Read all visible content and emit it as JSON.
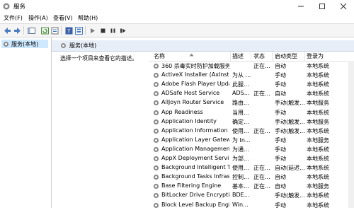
{
  "window": {
    "title": "服务"
  },
  "menu": [
    "文件(F)",
    "操作(A)",
    "查看(V)",
    "帮助(H)"
  ],
  "toolbar_icons": [
    "back-icon",
    "forward-icon",
    "console-tree-icon",
    "refresh-icon",
    "export-icon",
    "help-icon",
    "properties-icon",
    "play-icon",
    "stop-icon",
    "pause-icon",
    "restart-icon"
  ],
  "left_pane": {
    "item": "服务(本地)"
  },
  "right_pane": {
    "header": "服务(本地)",
    "description_hint": "选择一个项目来查看它的描述。"
  },
  "grid": {
    "columns": [
      "名称",
      "描述",
      "状态",
      "启动类型",
      "登录为"
    ],
    "rows": [
      {
        "name": "360 杀毒实时防护加载服务",
        "desc": "",
        "status": "正在...",
        "startup": "自动",
        "logon": "本地系统"
      },
      {
        "name": "ActiveX Installer (AxInstSV)",
        "desc": "为从 ...",
        "status": "",
        "startup": "手动",
        "logon": "本地系统"
      },
      {
        "name": "Adobe Flash Player Upda...",
        "desc": "此服...",
        "status": "",
        "startup": "手动",
        "logon": "本地系统"
      },
      {
        "name": "ADSafe Host Service",
        "desc": "ADS...",
        "status": "正在...",
        "startup": "自动",
        "logon": "本地系统"
      },
      {
        "name": "AllJoyn Router Service",
        "desc": "路由...",
        "status": "",
        "startup": "手动(触发...",
        "logon": "本地服务"
      },
      {
        "name": "App Readiness",
        "desc": "当用...",
        "status": "",
        "startup": "手动",
        "logon": "本地系统"
      },
      {
        "name": "Application Identity",
        "desc": "确定...",
        "status": "",
        "startup": "手动(触发...",
        "logon": "本地服务"
      },
      {
        "name": "Application Information",
        "desc": "使用...",
        "status": "正在...",
        "startup": "手动(触发...",
        "logon": "本地系统"
      },
      {
        "name": "Application Layer Gatewa...",
        "desc": "为 In...",
        "status": "",
        "startup": "手动",
        "logon": "本地服务"
      },
      {
        "name": "Application Management",
        "desc": "为通...",
        "status": "",
        "startup": "手动",
        "logon": "本地系统"
      },
      {
        "name": "AppX Deployment Servic...",
        "desc": "为部...",
        "status": "",
        "startup": "手动",
        "logon": "本地系统"
      },
      {
        "name": "Background Intelligent T...",
        "desc": "使用...",
        "status": "正在...",
        "startup": "自动(延迟...",
        "logon": "本地系统"
      },
      {
        "name": "Background Tasks Infras...",
        "desc": "控制...",
        "status": "正在...",
        "startup": "自动",
        "logon": "本地系统"
      },
      {
        "name": "Base Filtering Engine",
        "desc": "基本...",
        "status": "正在...",
        "startup": "自动",
        "logon": "本地服务"
      },
      {
        "name": "BitLocker Drive Encryptio...",
        "desc": "BDE...",
        "status": "",
        "startup": "手动(触发...",
        "logon": "本地系统"
      },
      {
        "name": "Block Level Backup Engi...",
        "desc": "Win...",
        "status": "",
        "startup": "手动",
        "logon": "本地系统"
      }
    ]
  },
  "colors": {
    "selection": "#cde8ff",
    "header_band": "#e8eef7",
    "icon_blue": "#3b78c4",
    "icon_gray": "#8a8a8a"
  }
}
